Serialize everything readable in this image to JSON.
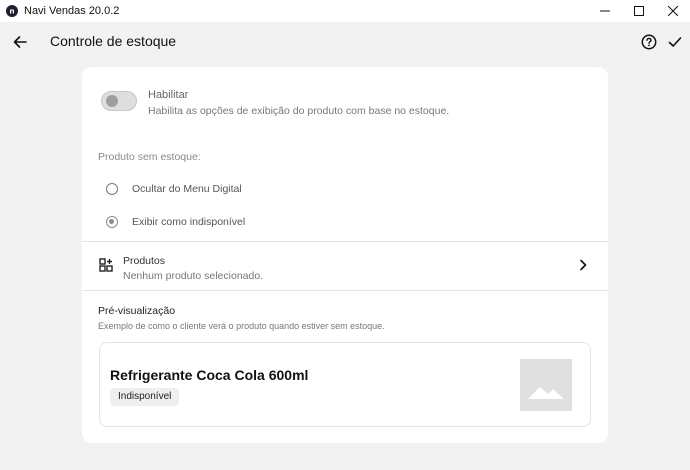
{
  "window": {
    "title": "Navi Vendas 20.0.2"
  },
  "header": {
    "title": "Controle de estoque"
  },
  "enable": {
    "title": "Habilitar",
    "description": "Habilita as opções de exibição do produto com base no estoque.",
    "on": false
  },
  "out_of_stock": {
    "label": "Produto sem estoque:",
    "options": [
      {
        "label": "Ocultar do Menu Digital",
        "selected": false
      },
      {
        "label": "Exibir como indisponível",
        "selected": true
      }
    ]
  },
  "products": {
    "title": "Produtos",
    "description": "Nenhum produto selecionado."
  },
  "preview": {
    "title": "Pré-visualização",
    "description": "Exemplo de como o cliente verá o produto quando estiver sem estoque.",
    "product_name": "Refrigerante Coca Cola 600ml",
    "status_badge": "Indisponível"
  },
  "icons": {
    "back": "arrow-left-icon",
    "help": "help-circle-icon",
    "confirm": "check-icon",
    "products": "grid-add-icon",
    "open": "chevron-right-icon",
    "image_placeholder": "image-placeholder-icon"
  },
  "colors": {
    "background": "#f2f2f2",
    "card": "#ffffff",
    "muted_text": "#777777"
  }
}
